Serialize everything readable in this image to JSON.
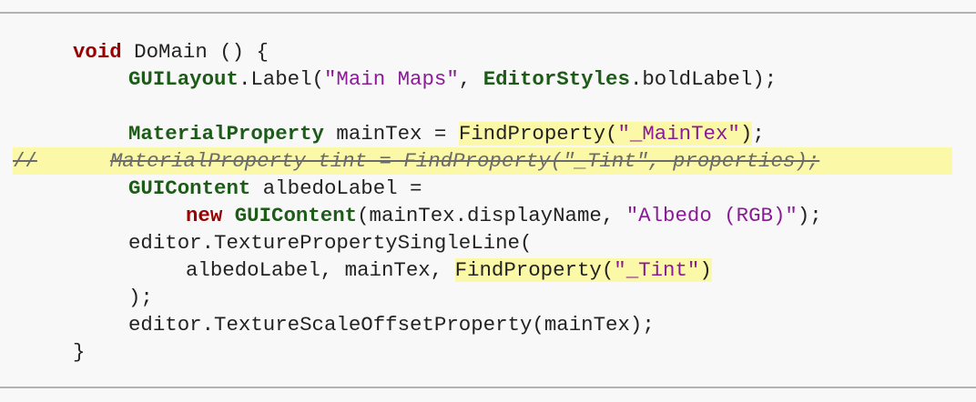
{
  "code": {
    "l1": {
      "kw": "void",
      "rest": " DoMain () {"
    },
    "l2": {
      "type1": "GUILayout",
      "mid": ".Label(",
      "str": "\"Main Maps\"",
      "sep": ", ",
      "type2": "EditorStyles",
      "end": ".boldLabel);"
    },
    "l4": {
      "type": "MaterialProperty",
      "mid": " mainTex = ",
      "fn": "FindProperty(",
      "str": "\"_MainTex\"",
      "close": ")",
      "end": ";"
    },
    "l5": {
      "marker": "//",
      "text": "MaterialProperty tint = FindProperty(\"_Tint\", properties);"
    },
    "l6": {
      "type": "GUIContent",
      "rest": " albedoLabel ="
    },
    "l7": {
      "kw": "new",
      "sp": " ",
      "type": "GUIContent",
      "mid": "(mainTex.displayName, ",
      "str": "\"Albedo (RGB)\"",
      "end": ");"
    },
    "l8": {
      "text": "editor.TexturePropertySingleLine("
    },
    "l9": {
      "pre": "albedoLabel, mainTex, ",
      "fn": "FindProperty(",
      "str": "\"_Tint\"",
      "close": ")"
    },
    "l10": {
      "text": ");"
    },
    "l11": {
      "text": "editor.TextureScaleOffsetProperty(mainTex);"
    },
    "l12": {
      "text": "}"
    }
  },
  "colors": {
    "keyword": "#990000",
    "type": "#1d5b18",
    "string": "#8a1a97",
    "highlight": "#fbf8a8"
  }
}
